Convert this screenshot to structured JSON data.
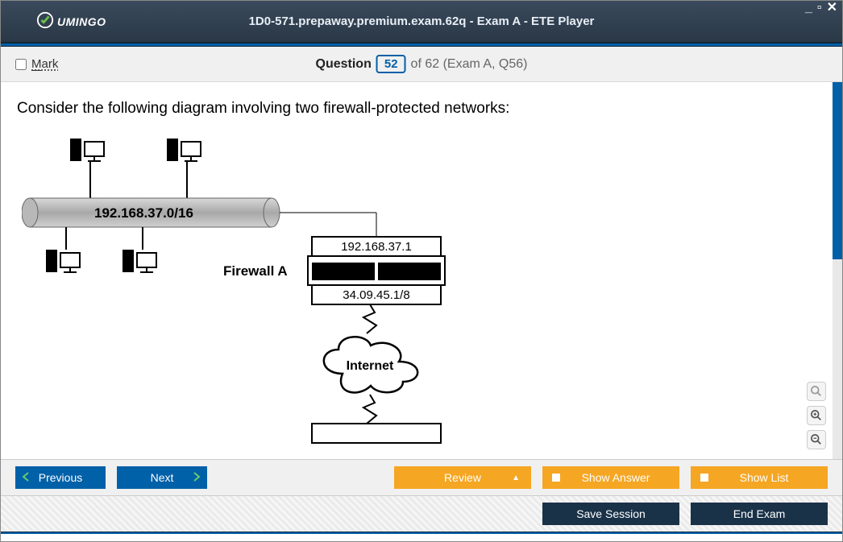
{
  "header": {
    "brand": "UMINGO",
    "title": "1D0-571.prepaway.premium.exam.62q - Exam A - ETE Player"
  },
  "question_bar": {
    "mark_label": "Mark",
    "question_label": "Question",
    "current_number": "52",
    "total_suffix": "of 62 (Exam A, Q56)"
  },
  "content": {
    "question_text": "Consider the following diagram involving two firewall-protected networks:",
    "diagram": {
      "network_cidr": "192.168.37.0/16",
      "firewall_a_label": "Firewall A",
      "firewall_a_top_ip": "192.168.37.1",
      "firewall_a_bottom_ip": "34.09.45.1/8",
      "internet_label": "Internet"
    }
  },
  "buttons": {
    "previous": "Previous",
    "next": "Next",
    "review": "Review",
    "show_answer": "Show Answer",
    "show_list": "Show List",
    "save_session": "Save Session",
    "end_exam": "End Exam"
  }
}
